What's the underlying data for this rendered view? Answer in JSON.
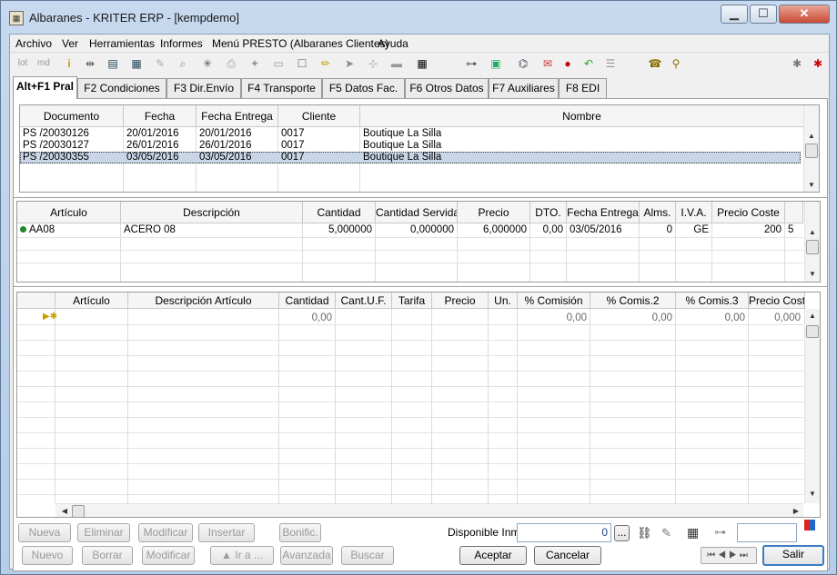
{
  "window": {
    "title": "Albaranes - KRITER ERP -  [kempdemo]",
    "app_icon": "albaran-app-icon",
    "buttons": [
      "minimize-icon",
      "maximize-icon",
      "close-icon"
    ]
  },
  "menu": [
    "Archivo",
    "Ver",
    "Herramientas",
    "Informes",
    "Menú PRESTO (Albaranes Clientes)",
    "Ayuda"
  ],
  "toolbar": {
    "lot": "lot",
    "md": "md"
  },
  "tabs": [
    "Alt+F1 Pral",
    "F2 Condiciones",
    "F3 Dir.Envío",
    "F4 Transporte",
    "F5 Datos Fac.",
    "F6 Otros Datos",
    "F7 Auxiliares",
    "F8 EDI"
  ],
  "docs": {
    "headers": [
      "Documento",
      "Fecha",
      "Fecha Entrega",
      "Cliente",
      "Nombre"
    ],
    "rows": [
      [
        "PS /20030126",
        "20/01/2016",
        "20/01/2016",
        "0017",
        "Boutique La Silla"
      ],
      [
        "PS /20030127",
        "26/01/2016",
        "26/01/2016",
        "0017",
        "Boutique La Silla"
      ],
      [
        "PS /20030355",
        "03/05/2016",
        "03/05/2016",
        "0017",
        "Boutique La Silla"
      ]
    ]
  },
  "lines": {
    "headers": [
      "Artículo",
      "Descripción",
      "Cantidad",
      "Cantidad Servida",
      "Precio",
      "DTO.",
      "Fecha Entrega",
      "Alms.",
      "I.V.A.",
      "Precio Coste"
    ],
    "rows": [
      [
        "AA08",
        "ACERO 08",
        "5,000000",
        "0,000000",
        "6,000000",
        "0,00",
        "03/05/2016",
        "0",
        "GE",
        "200",
        "5"
      ]
    ]
  },
  "detail": {
    "headers": [
      "Artículo",
      "Descripción Artículo",
      "Cantidad",
      "Cant.U.F.",
      "Tarifa",
      "Precio",
      "Un.",
      "% Comisión",
      "% Comis.2",
      "% Comis.3",
      "Precio Cost"
    ],
    "new_row": [
      "0,00",
      "0,00",
      "0,00",
      "0,00",
      "0,000"
    ]
  },
  "detail_buttons": [
    "Nueva",
    "Eliminar",
    "Modificar",
    "Insertar",
    "Bonific."
  ],
  "disponible": {
    "label": "Disponible Inm",
    "value": "0",
    "dots": "..."
  },
  "bottom_buttons": [
    "Nuevo",
    "Borrar",
    "Modificar",
    "▲ Ir a ...",
    "Avanzada",
    "Buscar"
  ],
  "accept": "Aceptar",
  "cancel": "Cancelar",
  "exit": "Salir"
}
